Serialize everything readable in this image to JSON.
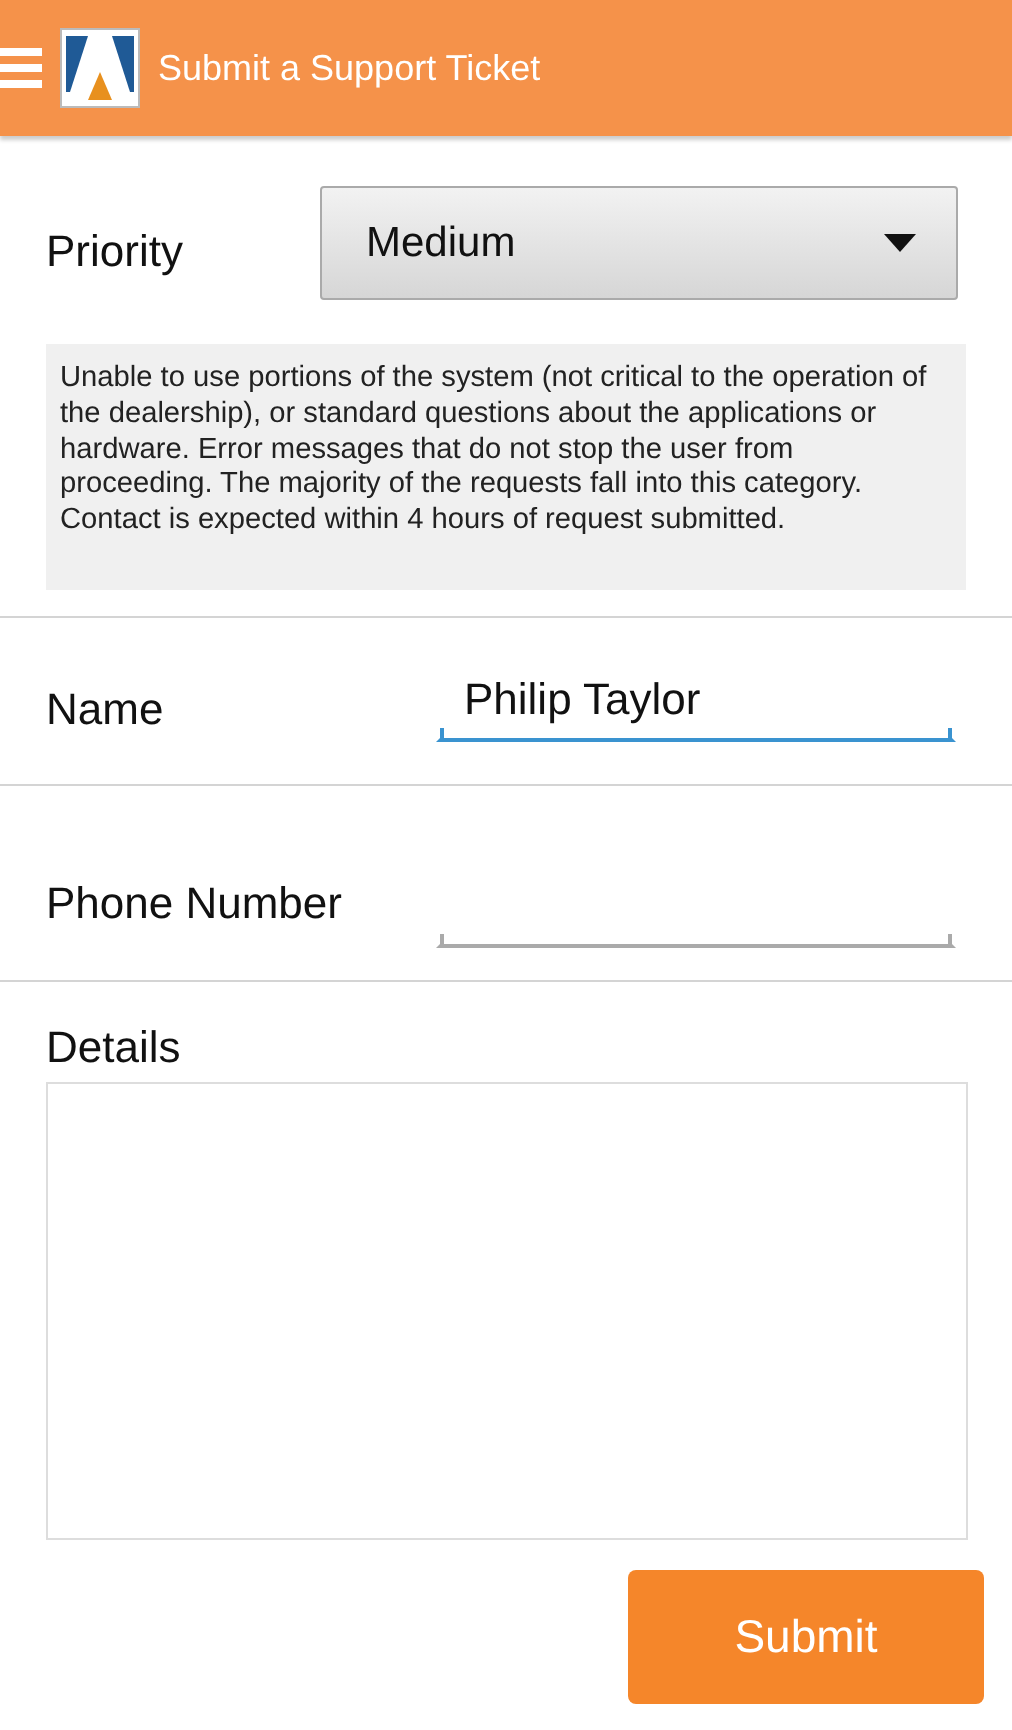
{
  "app_bar": {
    "title": "Submit a Support Ticket"
  },
  "priority": {
    "label": "Priority",
    "value": "Medium",
    "description": "Unable to use portions of the system (not critical to the operation of the dealership), or standard questions about the applications or hardware. Error messages that do not stop the user from proceeding. The majority of the requests fall into this category. Contact is expected within 4 hours of request submitted."
  },
  "fields": [
    {
      "label": "Name",
      "value": "Philip Taylor",
      "focused": true
    },
    {
      "label": "Phone Number",
      "focused": false
    }
  ],
  "details": {
    "label": "Details"
  },
  "submit_button": "Submit"
}
